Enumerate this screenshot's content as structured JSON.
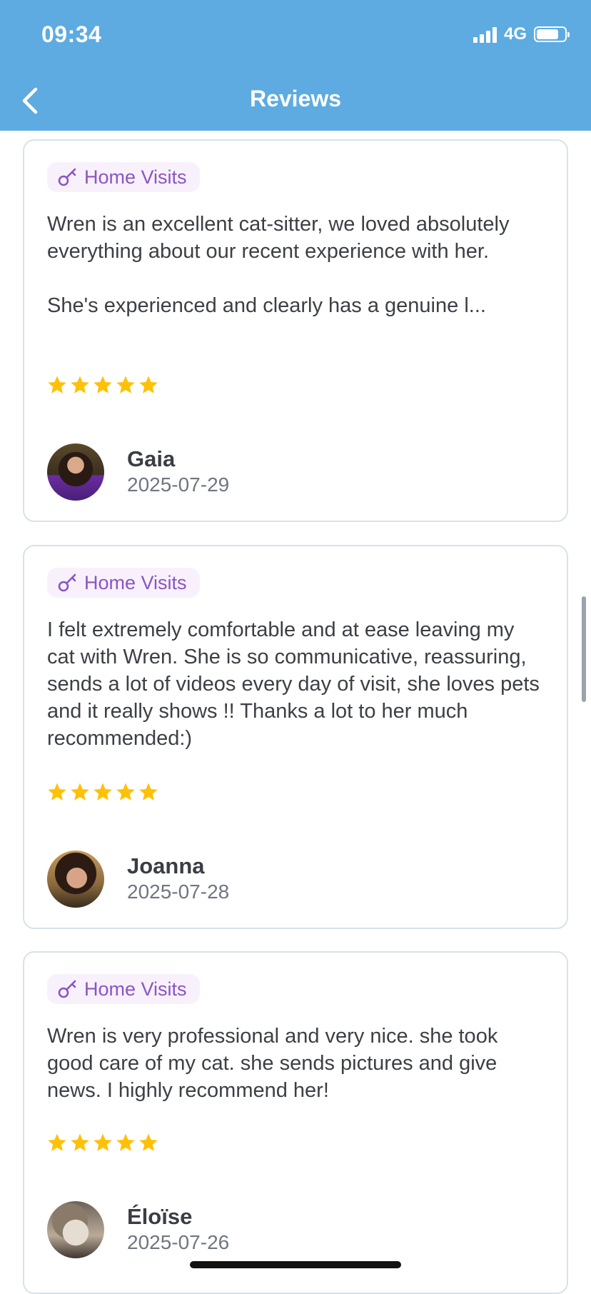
{
  "status_bar": {
    "time": "09:34",
    "network": "4G",
    "battery_level": 0.8
  },
  "header": {
    "title": "Reviews",
    "back_icon": "chevron-left-icon"
  },
  "colors": {
    "header": "#5DABE0",
    "star": "#FFC107",
    "badge_text": "#8A55C4",
    "badge_bg": "#F8F1FB"
  },
  "reviews": [
    {
      "service": "Home Visits",
      "text": "Wren is an excellent cat-sitter, we loved absolutely everything about our recent experience with her.\n\nShe's experienced and clearly has a genuine l...",
      "rating": 5,
      "name": "Gaia",
      "date": "2025-07-29"
    },
    {
      "service": "Home Visits",
      "text": "I felt extremely comfortable and at ease leaving my cat with Wren. She is so communicative, reassuring,  sends a lot of videos every day of visit, she loves pets and it really shows !! Thanks a lot to her much recommended:)",
      "rating": 5,
      "name": "Joanna",
      "date": "2025-07-28"
    },
    {
      "service": "Home Visits",
      "text": "Wren is very professional and very nice. she took good care of my cat. she sends pictures and give news. I highly recommend her!",
      "rating": 5,
      "name": "Éloïse",
      "date": "2025-07-26"
    }
  ]
}
